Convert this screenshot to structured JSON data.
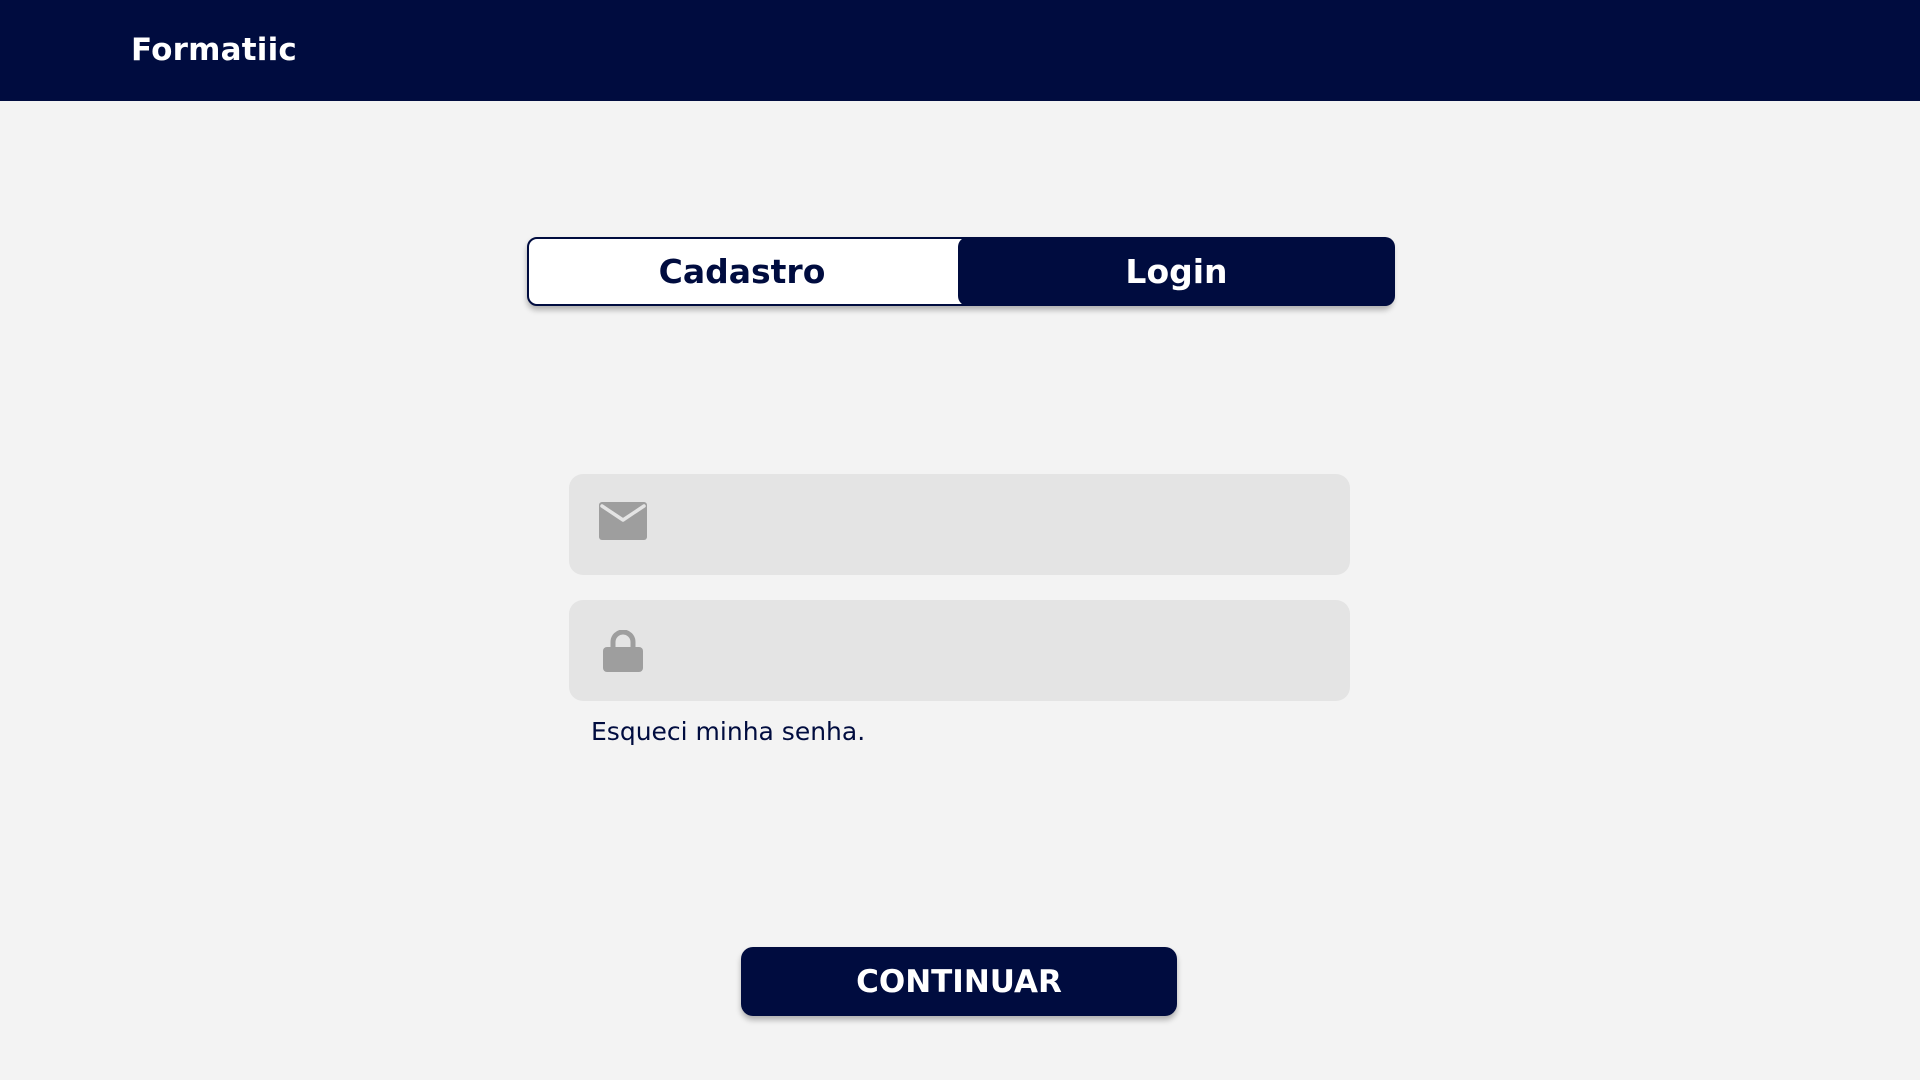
{
  "header": {
    "brand": "Formatiic"
  },
  "tabs": [
    {
      "label": "Cadastro",
      "active": false
    },
    {
      "label": "Login",
      "active": true
    }
  ],
  "form": {
    "email": {
      "value": "",
      "placeholder": "",
      "icon": "mail-icon"
    },
    "password": {
      "value": "",
      "placeholder": "",
      "icon": "lock-icon"
    },
    "forgot_label": "Esqueci minha senha.",
    "submit_label": "CONTINUAR"
  },
  "colors": {
    "primary": "#000c3f",
    "background": "#f3f3f3",
    "field": "#e4e4e4",
    "icon": "#9e9e9e"
  }
}
